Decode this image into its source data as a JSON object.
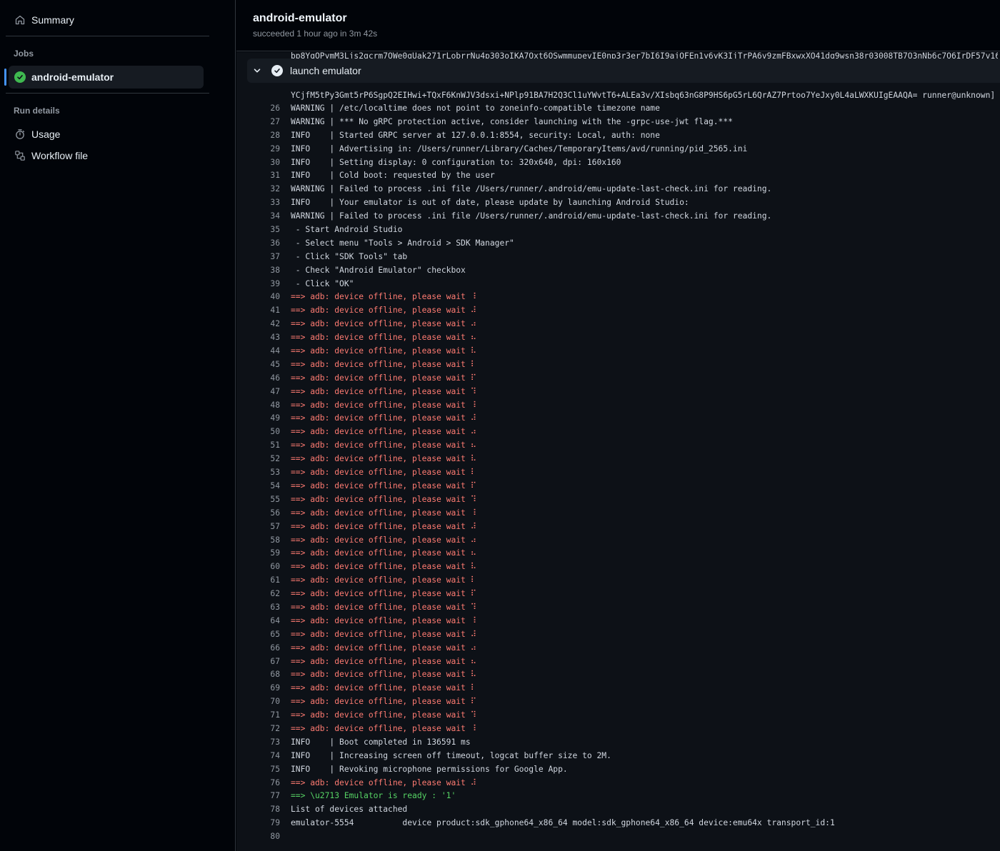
{
  "sidebar": {
    "summary_label": "Summary",
    "jobs_heading": "Jobs",
    "active_job": "android-emulator",
    "run_details_heading": "Run details",
    "usage_label": "Usage",
    "workflow_file_label": "Workflow file"
  },
  "header": {
    "title": "android-emulator",
    "status": "succeeded 1 hour ago in 3m 42s"
  },
  "step": {
    "name": "launch emulator"
  },
  "log": {
    "clipped_line": "bp8YgOPymM3Ljs2qcrm7QWe0gUak271rLobrrNu4p303oIKA7Qxt6OSwmmupevIE0np3r3er7bI6I9ajQFEn1y6yK3IjTrPA6v9zmFBxwxXQ41dq9wsn38r03008TB7O3nNb6c7Q6IrDF57v16",
    "continuation_line": "YCjfM5tPy3Gmt5rP6SgpQ2EIHwi+TQxF6KnWJV3dsxi+NPlp91BA7H2Q3Cl1uYWvtT6+ALEa3v/XIsbq63nG8P9HS6pG5rL6QrAZ7Prtoo7YeJxy0L4aLWXKUIgEAAQA= runner@unknown]",
    "lines": [
      {
        "n": "26",
        "t": "WARNING | /etc/localtime does not point to zoneinfo-compatible timezone name",
        "c": "plain"
      },
      {
        "n": "27",
        "t": "WARNING | *** No gRPC protection active, consider launching with the -grpc-use-jwt flag.***",
        "c": "plain"
      },
      {
        "n": "28",
        "t": "INFO    | Started GRPC server at 127.0.0.1:8554, security: Local, auth: none",
        "c": "plain"
      },
      {
        "n": "29",
        "t": "INFO    | Advertising in: /Users/runner/Library/Caches/TemporaryItems/avd/running/pid_2565.ini",
        "c": "plain"
      },
      {
        "n": "30",
        "t": "INFO    | Setting display: 0 configuration to: 320x640, dpi: 160x160",
        "c": "plain"
      },
      {
        "n": "31",
        "t": "INFO    | Cold boot: requested by the user",
        "c": "plain"
      },
      {
        "n": "32",
        "t": "WARNING | Failed to process .ini file /Users/runner/.android/emu-update-last-check.ini for reading.",
        "c": "plain"
      },
      {
        "n": "33",
        "t": "INFO    | Your emulator is out of date, please update by launching Android Studio:",
        "c": "plain"
      },
      {
        "n": "34",
        "t": "WARNING | Failed to process .ini file /Users/runner/.android/emu-update-last-check.ini for reading.",
        "c": "plain"
      },
      {
        "n": "35",
        "t": " - Start Android Studio",
        "c": "plain"
      },
      {
        "n": "36",
        "t": " - Select menu \"Tools > Android > SDK Manager\"",
        "c": "plain"
      },
      {
        "n": "37",
        "t": " - Click \"SDK Tools\" tab",
        "c": "plain"
      },
      {
        "n": "38",
        "t": " - Check \"Android Emulator\" checkbox",
        "c": "plain"
      },
      {
        "n": "39",
        "t": " - Click \"OK\"",
        "c": "plain"
      },
      {
        "n": "40",
        "t": "==> adb: device offline, please wait ⠸",
        "c": "red"
      },
      {
        "n": "41",
        "t": "==> adb: device offline, please wait ⠼",
        "c": "red"
      },
      {
        "n": "42",
        "t": "==> adb: device offline, please wait ⠴",
        "c": "red"
      },
      {
        "n": "43",
        "t": "==> adb: device offline, please wait ⠦",
        "c": "red"
      },
      {
        "n": "44",
        "t": "==> adb: device offline, please wait ⠧",
        "c": "red"
      },
      {
        "n": "45",
        "t": "==> adb: device offline, please wait ⠇",
        "c": "red"
      },
      {
        "n": "46",
        "t": "==> adb: device offline, please wait ⠏",
        "c": "red"
      },
      {
        "n": "47",
        "t": "==> adb: device offline, please wait ⠹",
        "c": "red"
      },
      {
        "n": "48",
        "t": "==> adb: device offline, please wait ⠸",
        "c": "red"
      },
      {
        "n": "49",
        "t": "==> adb: device offline, please wait ⠼",
        "c": "red"
      },
      {
        "n": "50",
        "t": "==> adb: device offline, please wait ⠴",
        "c": "red"
      },
      {
        "n": "51",
        "t": "==> adb: device offline, please wait ⠦",
        "c": "red"
      },
      {
        "n": "52",
        "t": "==> adb: device offline, please wait ⠧",
        "c": "red"
      },
      {
        "n": "53",
        "t": "==> adb: device offline, please wait ⠇",
        "c": "red"
      },
      {
        "n": "54",
        "t": "==> adb: device offline, please wait ⠏",
        "c": "red"
      },
      {
        "n": "55",
        "t": "==> adb: device offline, please wait ⠹",
        "c": "red"
      },
      {
        "n": "56",
        "t": "==> adb: device offline, please wait ⠸",
        "c": "red"
      },
      {
        "n": "57",
        "t": "==> adb: device offline, please wait ⠼",
        "c": "red"
      },
      {
        "n": "58",
        "t": "==> adb: device offline, please wait ⠴",
        "c": "red"
      },
      {
        "n": "59",
        "t": "==> adb: device offline, please wait ⠦",
        "c": "red"
      },
      {
        "n": "60",
        "t": "==> adb: device offline, please wait ⠧",
        "c": "red"
      },
      {
        "n": "61",
        "t": "==> adb: device offline, please wait ⠇",
        "c": "red"
      },
      {
        "n": "62",
        "t": "==> adb: device offline, please wait ⠏",
        "c": "red"
      },
      {
        "n": "63",
        "t": "==> adb: device offline, please wait ⠹",
        "c": "red"
      },
      {
        "n": "64",
        "t": "==> adb: device offline, please wait ⠸",
        "c": "red"
      },
      {
        "n": "65",
        "t": "==> adb: device offline, please wait ⠼",
        "c": "red"
      },
      {
        "n": "66",
        "t": "==> adb: device offline, please wait ⠴",
        "c": "red"
      },
      {
        "n": "67",
        "t": "==> adb: device offline, please wait ⠦",
        "c": "red"
      },
      {
        "n": "68",
        "t": "==> adb: device offline, please wait ⠧",
        "c": "red"
      },
      {
        "n": "69",
        "t": "==> adb: device offline, please wait ⠇",
        "c": "red"
      },
      {
        "n": "70",
        "t": "==> adb: device offline, please wait ⠏",
        "c": "red"
      },
      {
        "n": "71",
        "t": "==> adb: device offline, please wait ⠹",
        "c": "red"
      },
      {
        "n": "72",
        "t": "==> adb: device offline, please wait ⠸",
        "c": "red"
      },
      {
        "n": "73",
        "t": "INFO    | Boot completed in 136591 ms",
        "c": "plain"
      },
      {
        "n": "74",
        "t": "INFO    | Increasing screen off timeout, logcat buffer size to 2M.",
        "c": "plain"
      },
      {
        "n": "75",
        "t": "INFO    | Revoking microphone permissions for Google App.",
        "c": "plain"
      },
      {
        "n": "76",
        "t": "==> adb: device offline, please wait ⠼",
        "c": "red"
      },
      {
        "n": "77",
        "t": "==> \\u2713 Emulator is ready : '1'",
        "c": "green"
      },
      {
        "n": "78",
        "t": "List of devices attached",
        "c": "plain"
      },
      {
        "n": "79",
        "t": "emulator-5554          device product:sdk_gphone64_x86_64 model:sdk_gphone64_x86_64 device:emu64x transport_id:1",
        "c": "plain"
      },
      {
        "n": "80",
        "t": "",
        "c": "plain"
      }
    ]
  }
}
